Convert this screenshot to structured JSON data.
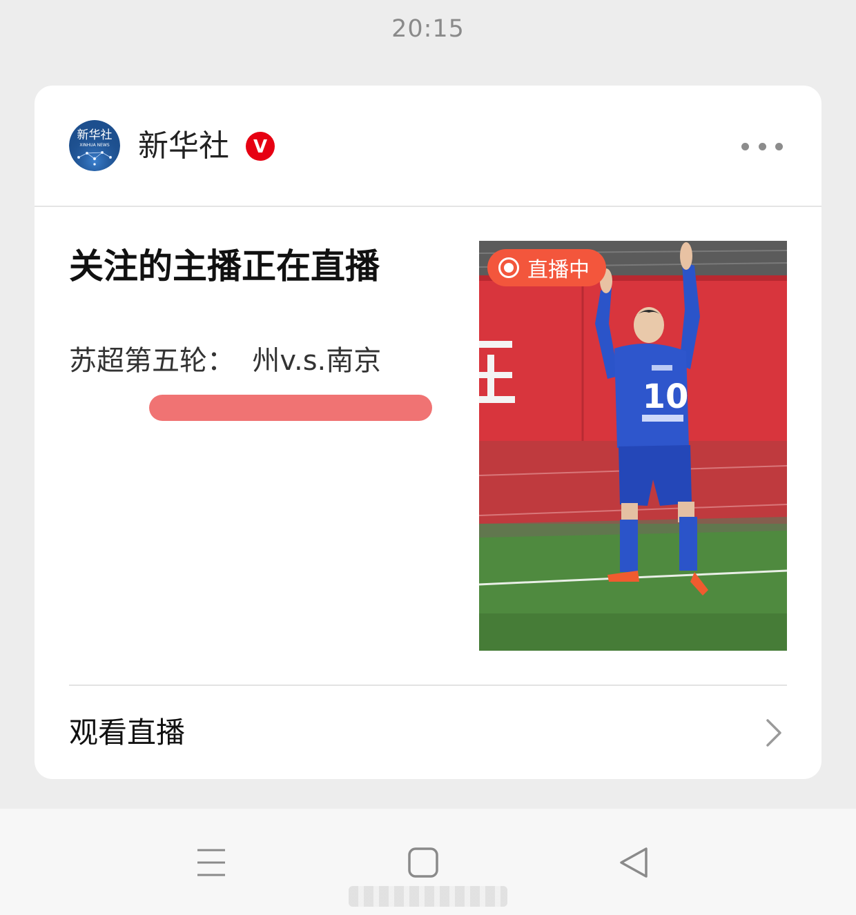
{
  "status_bar": {
    "time": "20:15"
  },
  "card": {
    "account": {
      "name": "新华社",
      "avatar_text": "新华社",
      "avatar_subtext": "XINHUA NEWS",
      "verified_mark": "V"
    },
    "title": "关注的主播正在直播",
    "subtitle": "苏超第五轮：  州v.s.南京",
    "thumbnail": {
      "live_badge": "直播中",
      "jersey_number": "10"
    },
    "action": {
      "label": "观看直播"
    }
  },
  "colors": {
    "background": "#ededed",
    "card": "#ffffff",
    "live_badge": "#f3563c",
    "verified": "#e60012",
    "redaction": "#ef6b6b"
  },
  "icons": {
    "more": "more-dots-icon",
    "chevron": "chevron-right-icon",
    "nav_menu": "menu-icon",
    "nav_home": "home-square-icon",
    "nav_back": "back-triangle-icon"
  }
}
